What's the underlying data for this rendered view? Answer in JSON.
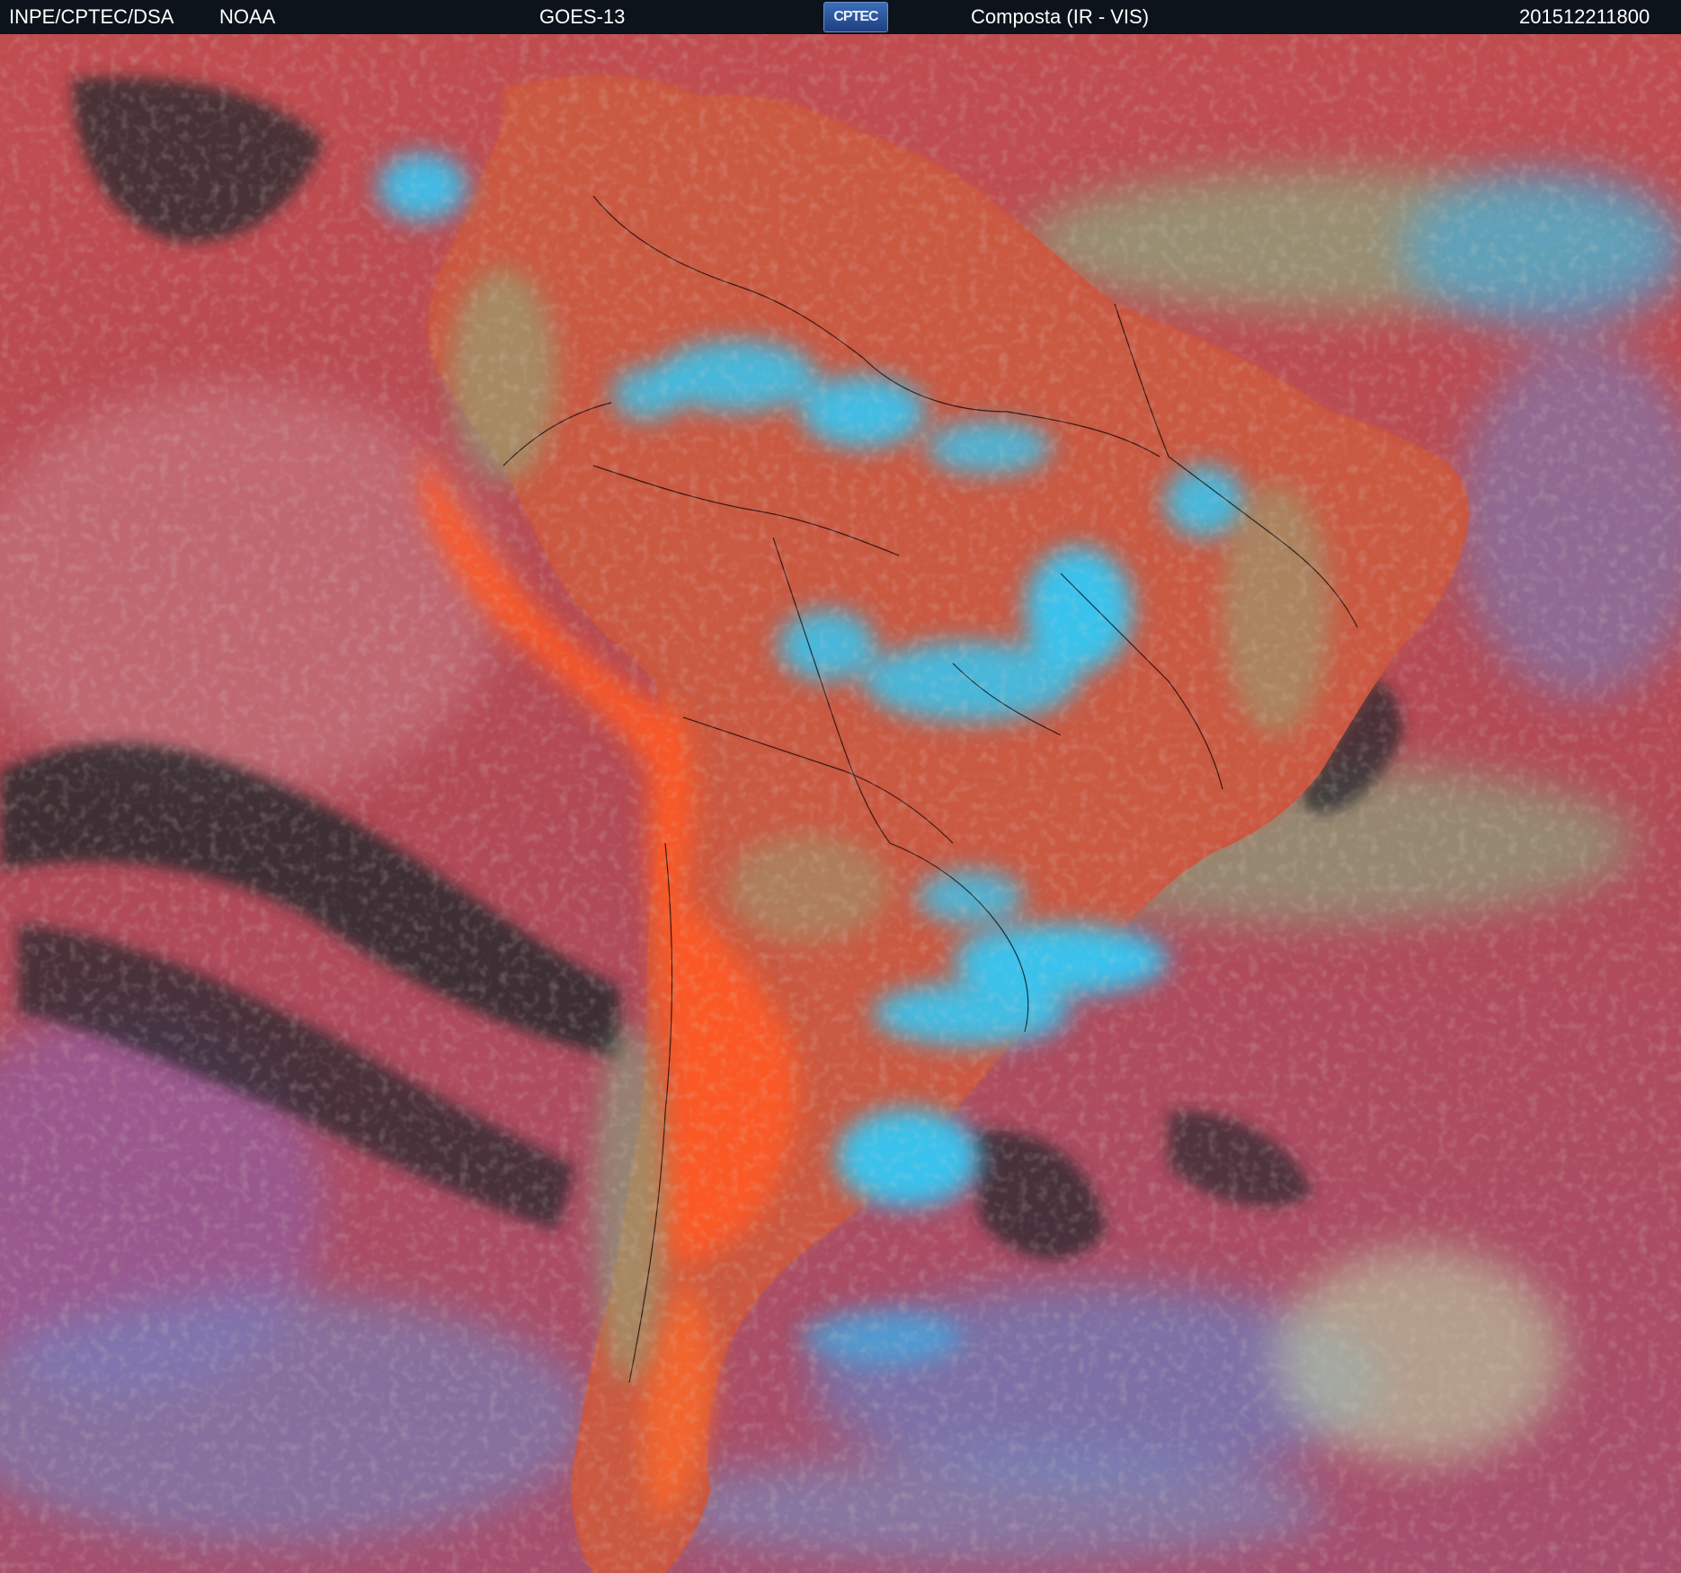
{
  "header": {
    "organization": "INPE/CPTEC/DSA",
    "agency": "NOAA",
    "satellite": "GOES-13",
    "logo_text": "CPTEC",
    "product": "Composta (IR - VIS)",
    "timestamp": "201512211800"
  },
  "colors": {
    "ocean_base": "#b64a52",
    "land_warm": "#c8503c",
    "hot_land": "#ff5a22",
    "cold_cloud": "#33c8f5",
    "mid_cloud": "#7cc48c",
    "clear_sky_dark": "#2a2a2e",
    "high_cloud_violet": "#8a62b0",
    "border_line": "#000000"
  },
  "icons": {
    "logo": "cptec-logo"
  }
}
